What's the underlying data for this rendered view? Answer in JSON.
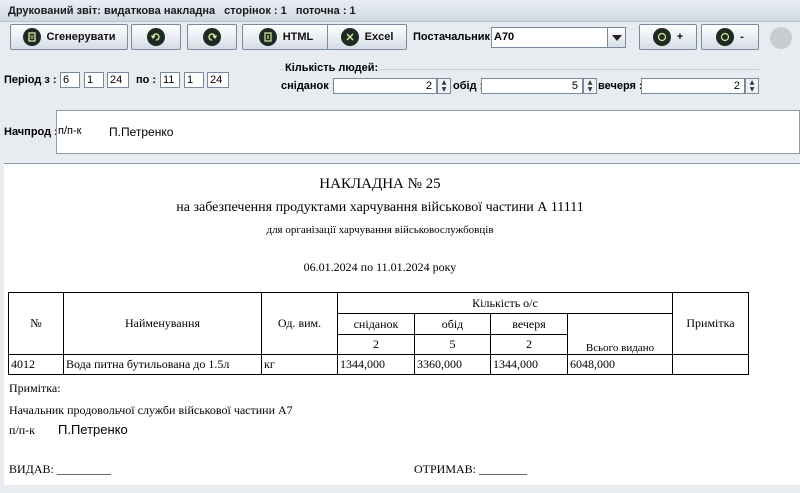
{
  "titlebar": {
    "title": "Друкований звіт: видаткова накладна",
    "pages": "сторінок : 1",
    "current": "поточна : 1"
  },
  "toolbar": {
    "generate": "Сгенерувати",
    "html": "HTML",
    "excel": "Excel",
    "supplier_label": "Постачальник:",
    "supplier_value": "A70",
    "add": "+",
    "remove": "-"
  },
  "period": {
    "from_label": "Період з :",
    "from": [
      "6",
      "1",
      "24"
    ],
    "to_label": "по :",
    "to": [
      "11",
      "1",
      "24"
    ]
  },
  "people": {
    "group_title": "Кількість людей:",
    "breakfast_label": "сніданок :",
    "breakfast": "2",
    "lunch_label": "обід :",
    "lunch": "5",
    "dinner_label": "вечеря :",
    "dinner": "2"
  },
  "chief": {
    "label": "Начпрод :",
    "prefix": "п/п-к",
    "name": "П.Петренко"
  },
  "report": {
    "title": "НАКЛАДНА № 25",
    "subtitle": "на забезпечення продуктами харчування військової частини А 11111",
    "subtitle2": "для організації харчування військовослужбовців",
    "period": "06.01.2024 по 11.01.2024 року",
    "table": {
      "h_no": "№",
      "h_name": "Найменування",
      "h_unit": "Од. вим.",
      "h_qty": "Кількість о/с",
      "h_breakfast": "сніданок",
      "h_lunch": "обід",
      "h_dinner": "вечеря",
      "h_total": "Всього видано",
      "h_note": "Примітка",
      "cnt_breakfast": "2",
      "cnt_lunch": "5",
      "cnt_dinner": "2",
      "row": {
        "no": "4012",
        "name": "Вода питна бутильована до 1.5л",
        "unit": "кг",
        "breakfast": "1344,000",
        "lunch": "3360,000",
        "dinner": "1344,000",
        "total": "6048,000",
        "note": ""
      }
    },
    "note_label": "Примітка:",
    "signer_title": "Начальник продовольчої служби військової частини А7",
    "signer_prefix": "п/п-к",
    "signer_name": "П.Петренко",
    "issued": "ВИДАВ: _________",
    "received": "ОТРИМАВ: ________"
  }
}
